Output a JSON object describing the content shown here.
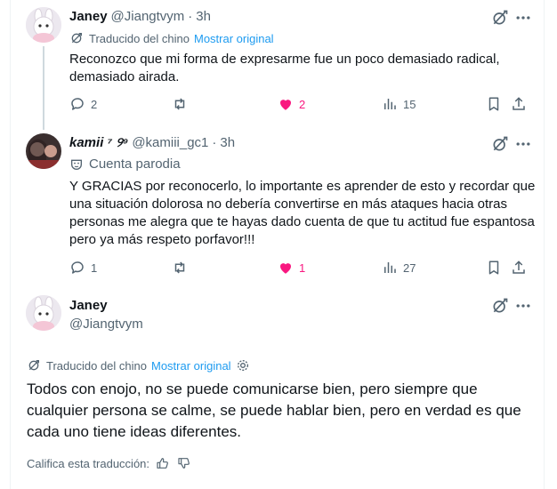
{
  "tweets": [
    {
      "display_name": "Janey",
      "handle": "@Jiangtvym",
      "time": "3h",
      "translated_label": "Traducido del chino",
      "show_original": "Mostrar original",
      "text": "Reconozco que mi forma de expresarme fue un poco demasiado radical, demasiado airada.",
      "replies": "2",
      "likes": "2",
      "views": "15"
    },
    {
      "display_name": "kamii ⁷ ୨⁹",
      "handle": "@kamiii_gc1",
      "time": "3h",
      "parody_label": "Cuenta parodia",
      "text": "Y GRACIAS por reconocerlo, lo importante es aprender de esto y recordar que una situación dolorosa no debería convertirse en más ataques hacia otras personas me alegra que te hayas dado cuenta de que tu actitud fue espantosa pero ya más respeto porfavor!!!",
      "replies": "1",
      "likes": "1",
      "views": "27"
    }
  ],
  "focused": {
    "display_name": "Janey",
    "handle": "@Jiangtvym",
    "translated_label": "Traducido del chino",
    "show_original": "Mostrar original",
    "text": "Todos con enojo, no se puede comunicarse bien, pero siempre que cualquier persona se calme, se puede hablar bien, pero en verdad es que cada uno tiene ideas diferentes.",
    "rate_label": "Califica esta traducción:"
  },
  "colors": {
    "accent": "#1d9bf0",
    "like": "#f91880",
    "muted": "#536471"
  },
  "icons": [
    "grok-icon",
    "more-icon",
    "translate-icon",
    "reply-icon",
    "repost-icon",
    "heart-icon",
    "views-icon",
    "bookmark-icon",
    "share-icon",
    "parody-mask-icon",
    "settings-icon",
    "thumbs-up-icon",
    "thumbs-down-icon"
  ]
}
